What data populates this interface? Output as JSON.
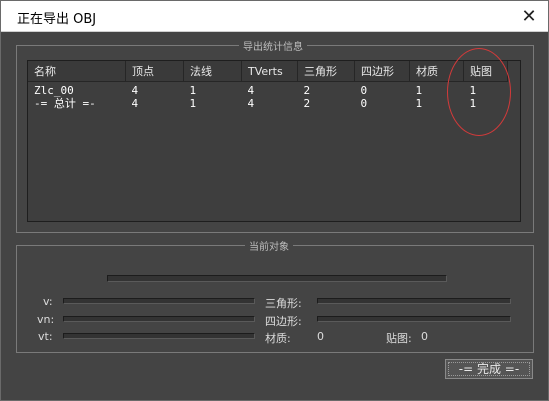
{
  "window": {
    "title": "正在导出 OBJ",
    "close_label": "✕"
  },
  "stats": {
    "group_title": "导出统计信息",
    "columns": [
      "名称",
      "顶点",
      "法线",
      "TVerts",
      "三角形",
      "四边形",
      "材质",
      "贴图"
    ],
    "rows": [
      [
        "Zlc_00",
        "4",
        "1",
        "4",
        "2",
        "0",
        "1",
        "1"
      ],
      [
        "-= 总计 =-",
        "4",
        "1",
        "4",
        "2",
        "0",
        "1",
        "1"
      ]
    ]
  },
  "current": {
    "group_title": "当前对象",
    "v_label": "v:",
    "vn_label": "vn:",
    "vt_label": "vt:",
    "tri_label": "三角形:",
    "quad_label": "四边形:",
    "material_label": "材质:",
    "material_value": "0",
    "texture_label": "贴图:",
    "texture_value": "0"
  },
  "buttons": {
    "finish": "-= 完成 =-"
  },
  "colors": {
    "annotation_circle": "#d23a3a"
  }
}
